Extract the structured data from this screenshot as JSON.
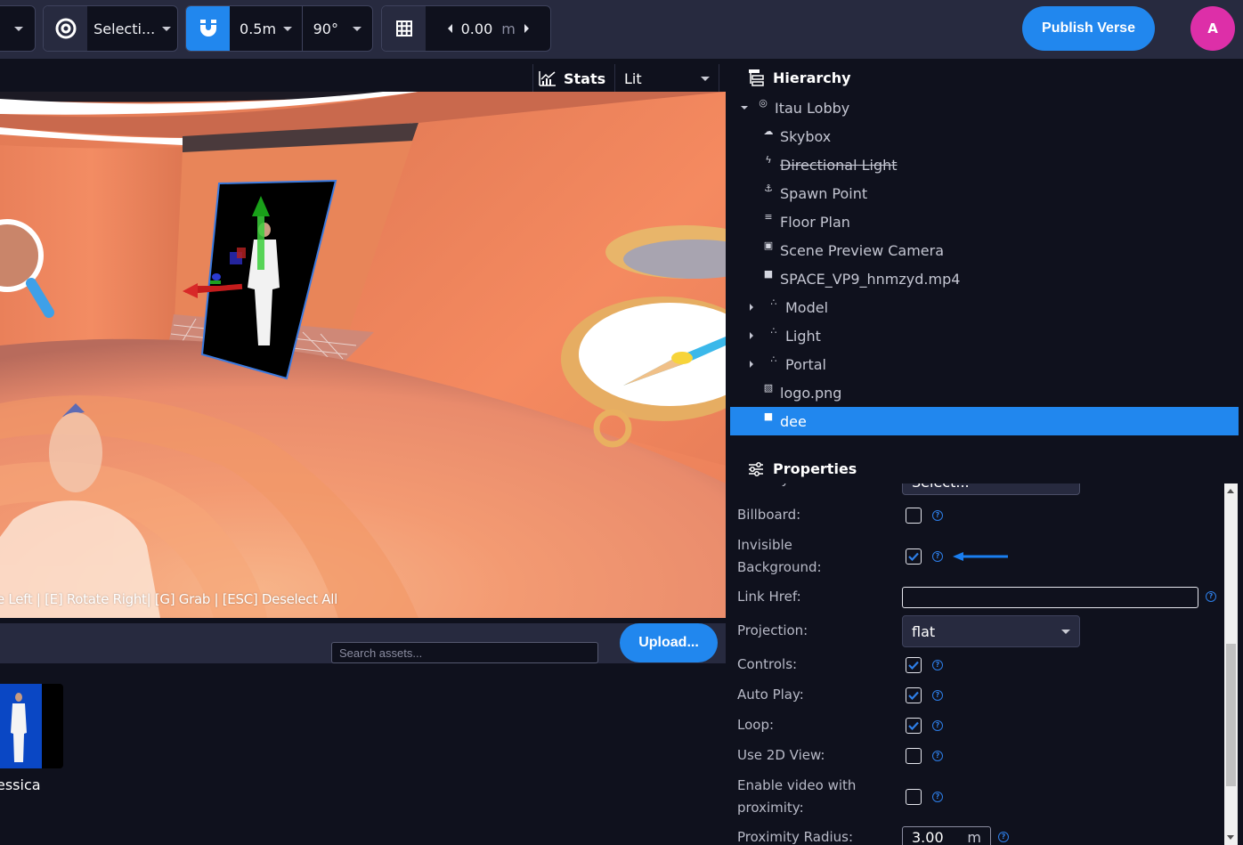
{
  "toolbar": {
    "transform_mode": "Selecti...",
    "snap_translate": "0.5m",
    "snap_rotate": "90°",
    "grid_height": "0.00",
    "grid_unit": "m",
    "publish_label": "Publish Verse",
    "avatar_initial": "A",
    "colors": {
      "accent": "#2187ee",
      "avatar": "#dd2fa8",
      "bar": "#272a3f"
    }
  },
  "viewport": {
    "stats_label": "Stats",
    "render_mode": "Lit",
    "shortcut_hint": "e Left | [E] Rotate Right| [G] Grab | [ESC] Deselect All"
  },
  "assets": {
    "search_placeholder": "Search assets...",
    "upload_label": "Upload...",
    "items": [
      {
        "label": "essica"
      }
    ]
  },
  "hierarchy": {
    "title": "Hierarchy",
    "items": [
      {
        "label": "Itau Lobby",
        "icon": "globe-icon",
        "expander": "down"
      },
      {
        "label": "Skybox",
        "icon": "cloud-icon"
      },
      {
        "label": "Directional Light",
        "icon": "bolt-icon",
        "disabled": true
      },
      {
        "label": "Spawn Point",
        "icon": "spawn-point-icon"
      },
      {
        "label": "Floor Plan",
        "icon": "floor-plan-icon"
      },
      {
        "label": "Scene Preview Camera",
        "icon": "camera-icon"
      },
      {
        "label": "SPACE_VP9_hnmzyd.mp4",
        "icon": "video-icon"
      },
      {
        "label": "Model",
        "icon": "cubes-icon",
        "expander": "right"
      },
      {
        "label": "Light",
        "icon": "cubes-icon",
        "expander": "right"
      },
      {
        "label": "Portal",
        "icon": "cubes-icon",
        "expander": "right"
      },
      {
        "label": "logo.png",
        "icon": "image-icon"
      },
      {
        "label": "dee",
        "icon": "video-icon",
        "selected": true
      }
    ]
  },
  "properties": {
    "title": "Properties",
    "destroy_on_finish_label": "Destroy on finish:",
    "destroy_on_finish_value": "Select...",
    "billboard_label": "Billboard:",
    "billboard": false,
    "invisible_background_label_1": "Invisible",
    "invisible_background_label_2": "Background:",
    "invisible_background": true,
    "link_href_label": "Link Href:",
    "link_href_value": "",
    "projection_label": "Projection:",
    "projection_value": "flat",
    "controls_label": "Controls:",
    "controls": true,
    "auto_play_label": "Auto Play:",
    "auto_play": true,
    "loop_label": "Loop:",
    "loop": true,
    "use_2d_view_label": "Use 2D View:",
    "use_2d_view": false,
    "enable_proximity_label_1": "Enable video with",
    "enable_proximity_label_2": "proximity:",
    "enable_proximity": false,
    "proximity_radius_label": "Proximity Radius:",
    "proximity_radius_value": "3.00",
    "proximity_radius_unit": "m"
  }
}
